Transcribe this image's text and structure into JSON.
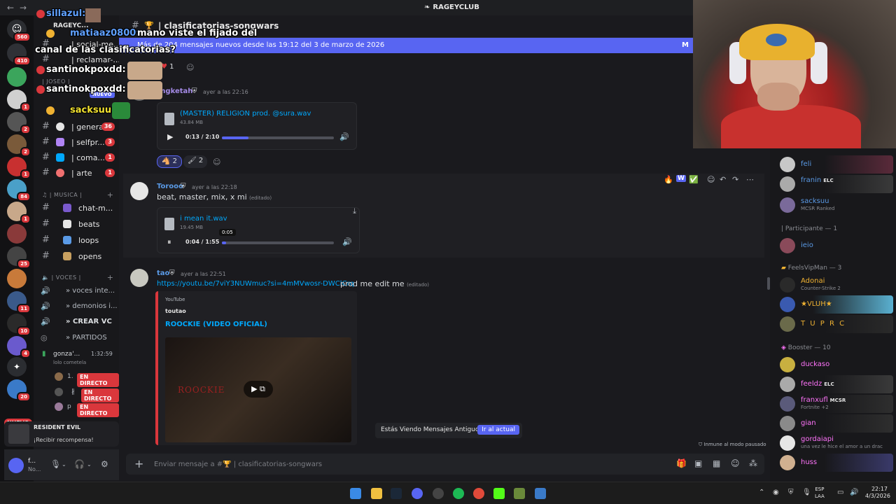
{
  "titlebar": {
    "back": "←",
    "forward": "→",
    "server_name": "RAGEYCLUB"
  },
  "rail": {
    "badges": [
      "560",
      "410",
      "1",
      "2",
      "2",
      "1",
      "84",
      "1",
      "25",
      "11",
      "10",
      "4",
      "20"
    ],
    "new_label": "NUEVO"
  },
  "sidebar": {
    "server_title": "RAGEYC...",
    "channels_top": [
      {
        "name": "| social-me...",
        "count": ""
      },
      {
        "name": "| reclamar-...",
        "count": ""
      }
    ],
    "category_joseo": "| JOSEO |",
    "new_badge": "NUEVO",
    "channels_mid": [
      {
        "name": "| general",
        "count": "36"
      },
      {
        "name": "| selfpr...",
        "count": "3"
      },
      {
        "name": "| coma...",
        "count": "1"
      },
      {
        "name": "| arte",
        "count": "1"
      }
    ],
    "category_musica": "| MUSICA |",
    "channels_music": [
      {
        "name": "chat-m..."
      },
      {
        "name": "beats"
      },
      {
        "name": "loops"
      },
      {
        "name": "opens"
      }
    ],
    "category_voces": "| VOCES |",
    "voice_channels": [
      {
        "name": "» voces inte..."
      },
      {
        "name": "» demonios i..."
      },
      {
        "name": "» CREAR VC"
      },
      {
        "name": "» PARTIDOS"
      }
    ],
    "active_call": {
      "name": "gonza'...",
      "duration": "1:32:59",
      "status": "lolo cometela"
    },
    "voice_users": [
      {
        "name": "1.",
        "badge": "EN DIRECTO"
      },
      {
        "name": "∦",
        "badge": "EN DIRECTO"
      },
      {
        "name": "p",
        "badge": "EN DIRECTO"
      }
    ],
    "promo": {
      "title": "RESIDENT EVIL",
      "subtitle": "¡Recibir recompensa!"
    },
    "user": {
      "name": "f...",
      "status": "No..."
    }
  },
  "chat": {
    "channel_title": "| clasificatorias-songwars",
    "new_messages_bar": "Más de 204 mensajes nuevos desde las 19:12 del 3 de marzo de 2026",
    "new_messages_mark": "M",
    "top_reaction": {
      "emoji": "♥",
      "count": "1"
    },
    "messages": [
      {
        "author": "mgketah",
        "time": "ayer a las 22:16",
        "attachment": {
          "name": "(MASTER) RELIGION prod. @sura.wav",
          "size": "43.84 MB",
          "time": "0:13 / 2:10",
          "progress": 0.24
        },
        "reactions": [
          {
            "emoji": "🐴",
            "count": "2"
          },
          {
            "emoji": "🖌",
            "count": "2"
          }
        ]
      },
      {
        "author": "Torooo",
        "time": "ayer a las 22:18",
        "text": "beat, master, mix, x mi",
        "edited": "(editado)",
        "attachment": {
          "name": "i mean it.wav",
          "size": "19.45 MB",
          "time": "0:04 / 1:55",
          "progress": 0.04,
          "tooltip": "0:05"
        }
      },
      {
        "author": "tao",
        "time": "ayer a las 22:51",
        "link": "https://youtu.be/7viY3NUWmuc?si=4mMVwosr-DWClCrq",
        "text": "prod me edit me",
        "edited": "(editado)",
        "embed": {
          "provider": "YouTube",
          "author": "toutao",
          "title": "ROOCKIE (VIDEO OFICIAL)",
          "thumb_text": "ROOCKIE"
        }
      }
    ],
    "hover_toolbar": [
      "🔥",
      "W",
      "✅",
      "☺",
      "↶",
      "↷",
      "⋯"
    ],
    "toast": {
      "text": "Estás Viendo Mensajes Antiguos",
      "button": "Ir al actual"
    },
    "slowmode": "Inmune al modo pausado",
    "composer_placeholder": "Enviar mensaje a #🏆 | clasificatorias-songwars"
  },
  "members": {
    "top": [
      {
        "name": "feli",
        "color": "#b5bac1",
        "status": ""
      },
      {
        "name": "franin",
        "tag": "ELC",
        "color": "#b5bac1",
        "status": ""
      },
      {
        "name": "sacksuu",
        "color": "#b5bac1",
        "status": "MCSR Ranked"
      }
    ],
    "group_participante": "| Participante — 1",
    "participante": [
      {
        "name": "ieio",
        "color": "#b5bac1"
      }
    ],
    "group_vip": "FeelsVipMan — 3",
    "vip": [
      {
        "name": "Adonai",
        "color": "#f0b232",
        "status": "Counter-Strike 2"
      },
      {
        "name": "★VLUH★",
        "color": "#f0b232",
        "status": ""
      },
      {
        "name": "T U P R C",
        "color": "#f0b232",
        "status": ""
      }
    ],
    "group_booster": "Booster — 10",
    "booster": [
      {
        "name": "duckaso",
        "color": "#ff73fa",
        "status": ""
      },
      {
        "name": "feeldz",
        "tag": "ELC",
        "color": "#ff73fa",
        "status": ""
      },
      {
        "name": "franxufl",
        "tag": "MCSR",
        "color": "#ff73fa",
        "status": "Fortnite +2"
      },
      {
        "name": "gian",
        "color": "#ff73fa",
        "status": ""
      },
      {
        "name": "gordaiapi",
        "color": "#ff73fa",
        "status": "una vez le hice el amor a un drac"
      },
      {
        "name": "huss",
        "color": "#ff73fa",
        "status": ""
      }
    ]
  },
  "overlay": {
    "lines": [
      {
        "user": "sillazul:",
        "msg": "",
        "color": "#5fa0ff"
      },
      {
        "user": "matiaaz0800:",
        "msg": "mano viste el fijado del",
        "color": "#5fa0ff"
      },
      {
        "user": "",
        "msg": "canal de las clasificatorias?",
        "color": "#ffffff"
      },
      {
        "user": "santinokpoxdd:",
        "msg": "",
        "color": "#ffffff"
      },
      {
        "user": "santinokpoxdd:",
        "msg": "",
        "color": "#ffffff"
      },
      {
        "user": "sacksuu:",
        "msg": "",
        "color": "#f0e030"
      }
    ]
  },
  "taskbar": {
    "lang": "ESP\nLAA",
    "time": "22:17",
    "date": "4/3/2026"
  }
}
